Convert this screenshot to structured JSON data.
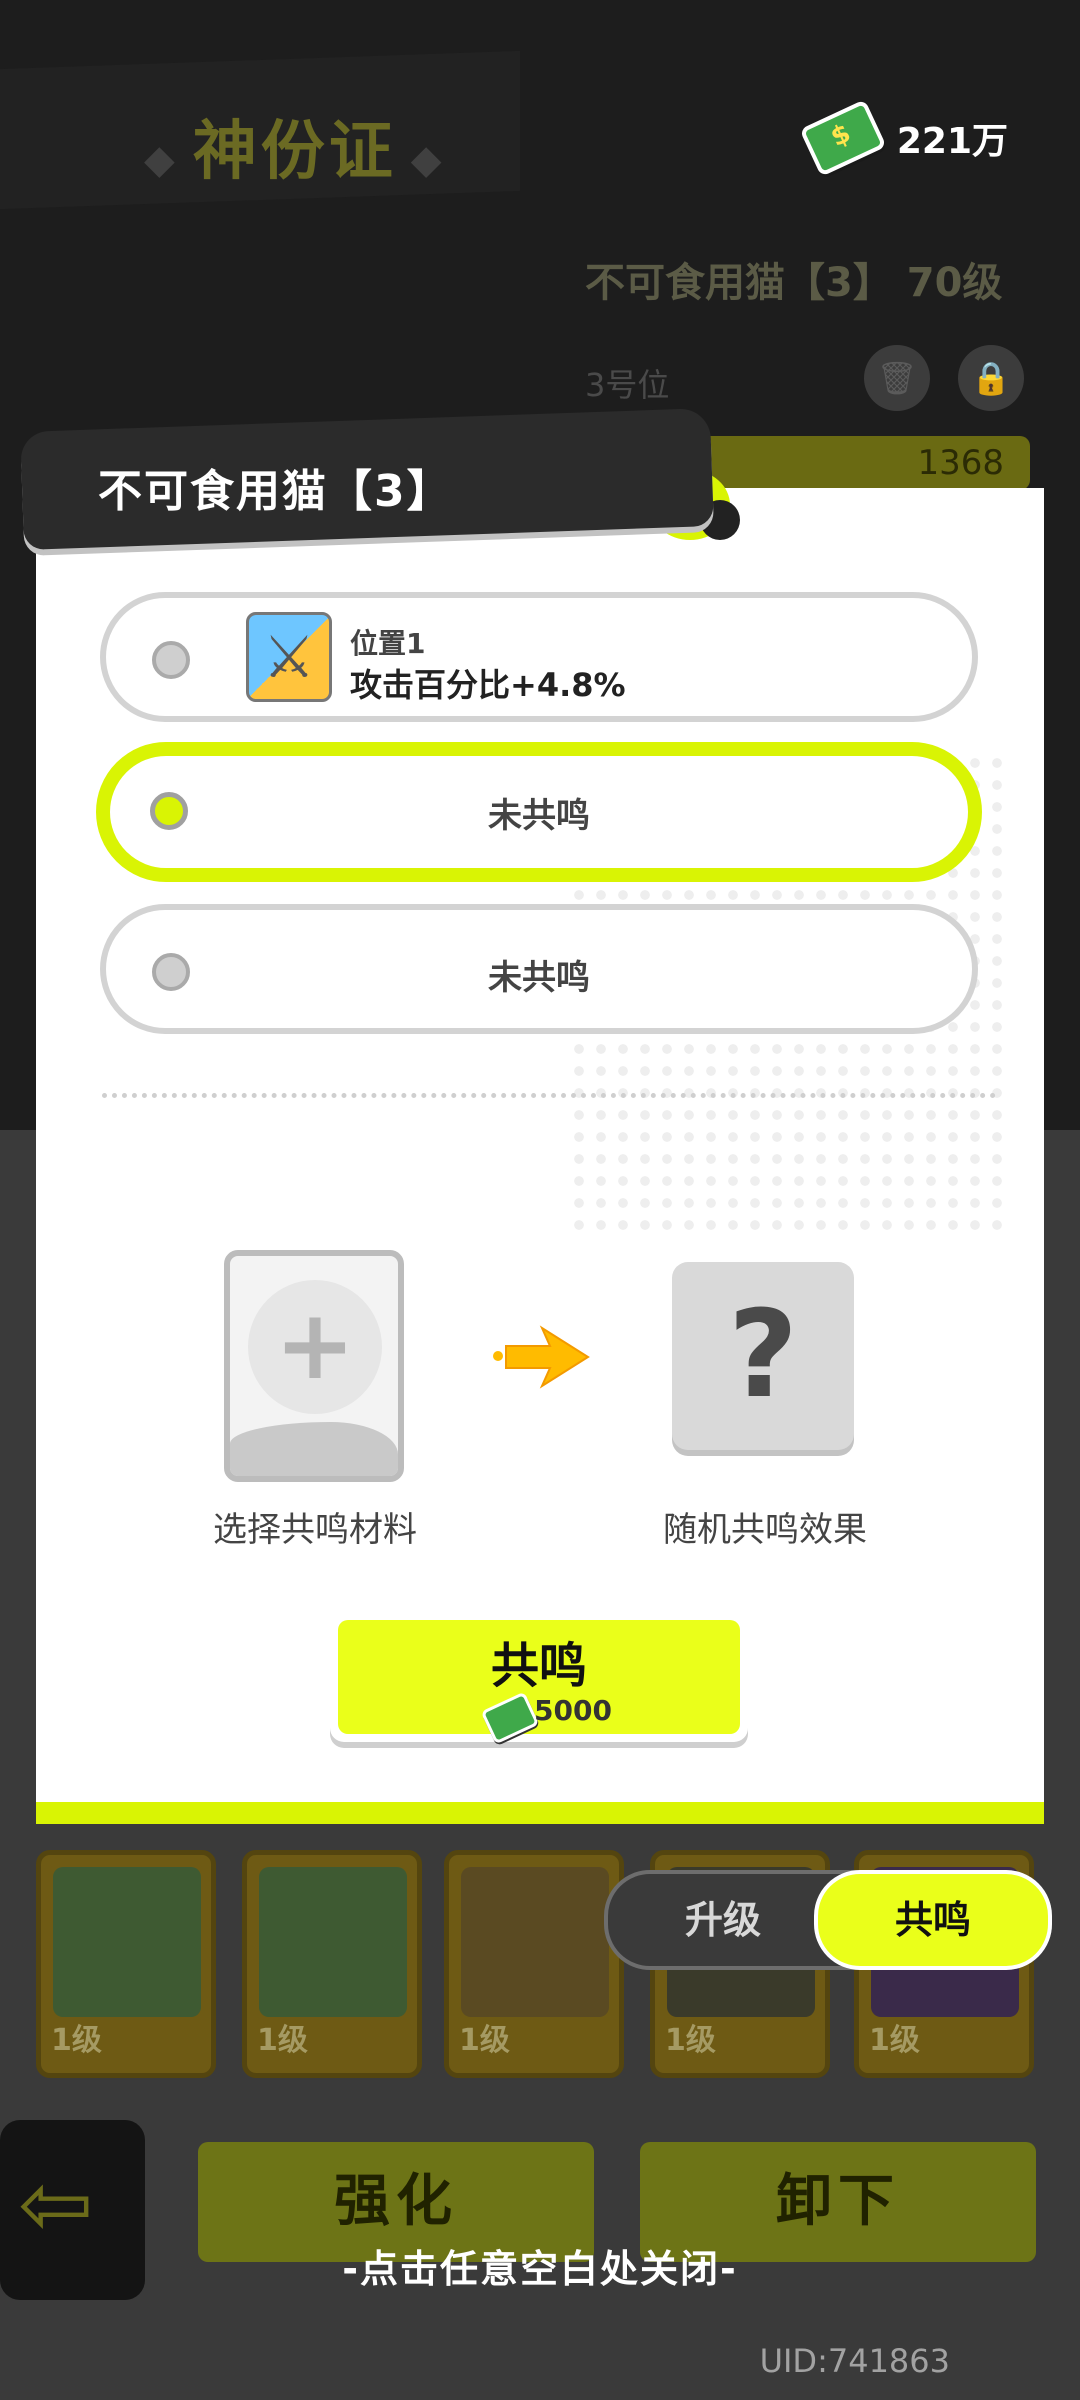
{
  "background": {
    "title": "神份证",
    "currency_value": "221万",
    "cat_name_level": "不可食用猫【3】 70级",
    "position_label": "3号位",
    "power_value": "1368",
    "cards": [
      {
        "level": "1级"
      },
      {
        "level": "1级"
      },
      {
        "level": "1级"
      },
      {
        "level": "1级"
      },
      {
        "level": "1级"
      }
    ],
    "toggle": {
      "upgrade_label": "升级",
      "resonate_label": "共鸣"
    },
    "strengthen_label": "强化",
    "unequip_label": "卸下",
    "close_hint": "-点击任意空白处关闭-",
    "uid": "UID:741863"
  },
  "modal": {
    "title": "不可食用猫【3】",
    "slots": [
      {
        "position_label": "位置1",
        "effect": "攻击百分比+4.8%",
        "selected": false,
        "icon": "sword-shield-icon"
      },
      {
        "label": "未共鸣",
        "selected": true
      },
      {
        "label": "未共鸣",
        "selected": false
      }
    ],
    "material_caption": "选择共鸣材料",
    "result_symbol": "?",
    "result_caption": "随机共鸣效果",
    "resonate_button": {
      "label": "共鸣",
      "cost": "5000"
    },
    "colors": {
      "accent": "#d9f404",
      "button": "#eaff1a"
    }
  }
}
